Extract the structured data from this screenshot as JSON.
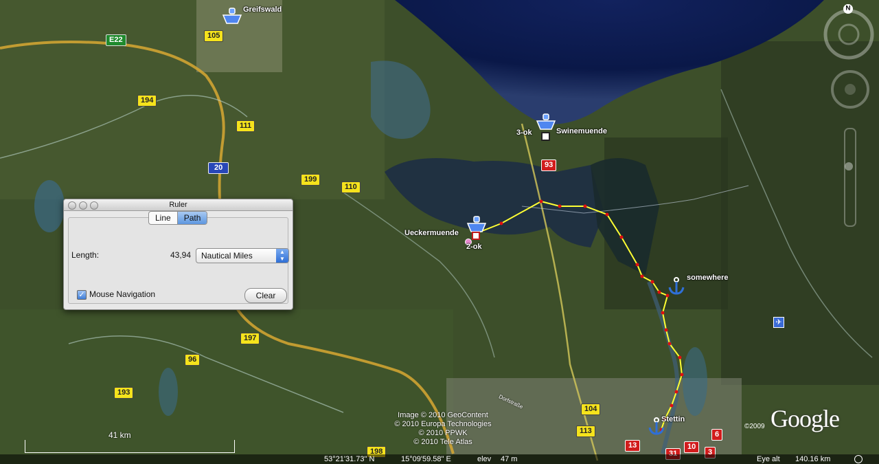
{
  "map": {
    "places": {
      "greifswald": "Greifswald",
      "swinemuende": "Swinemuende",
      "ueckermuende": "Ueckermuende",
      "somewhere": "somewhere",
      "stettin": "Stettin",
      "ok2": "2-ok",
      "ok3": "3-ok",
      "dorfstrasse": "Dorfstraße"
    },
    "roads": {
      "e22": "E22",
      "r105": "105",
      "r194": "194",
      "r111": "111",
      "a20": "20",
      "r199": "199",
      "r110": "110",
      "r93": "93",
      "r197": "197",
      "r96": "96",
      "r193": "193",
      "r198": "198",
      "r104": "104",
      "r113": "113",
      "r13": "13",
      "r31": "31",
      "r10": "10",
      "r3": "3",
      "r6": "6"
    },
    "scale_label": "41 km",
    "credits": [
      "Image © 2010 GeoContent",
      "© 2010 Europa Technologies",
      "© 2010 PPWK",
      "© 2010 Tele Atlas"
    ],
    "copyright_year": "©2009",
    "logo": "Google",
    "colors": {
      "path": "#ffff33",
      "path_nodes": "#e01010",
      "sea": "#0b1a4a"
    }
  },
  "ruler": {
    "title": "Ruler",
    "tabs": [
      "Line",
      "Path"
    ],
    "active_tab": "Path",
    "length_label": "Length:",
    "length_value": "43,94",
    "unit": "Nautical Miles",
    "mouse_nav_label": "Mouse Navigation",
    "mouse_nav_checked": true,
    "clear_label": "Clear"
  },
  "status": {
    "lat": "53°21'31.73\" N",
    "lon": "15°09'59.58\" E",
    "elev_label": "elev",
    "elev": "47 m",
    "eye_alt_label": "Eye alt",
    "eye_alt": "140.16 km"
  }
}
